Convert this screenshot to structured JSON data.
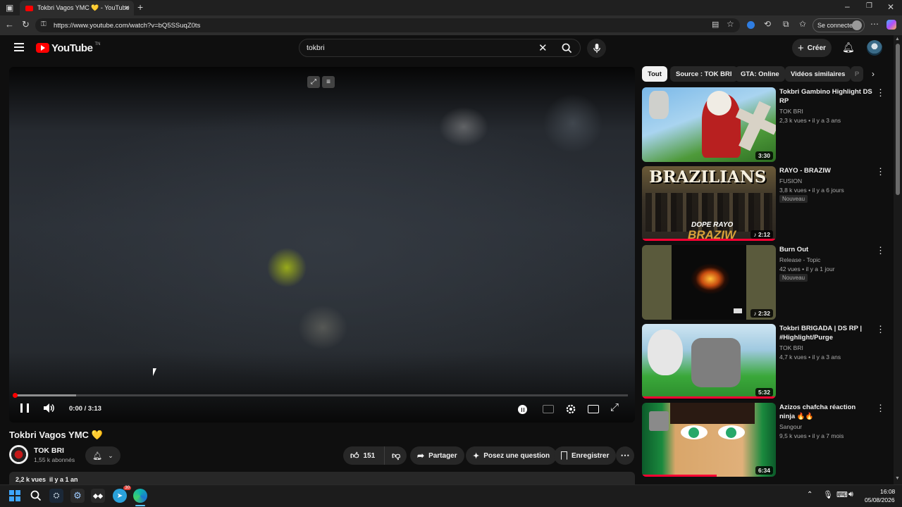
{
  "browser": {
    "tab_title": "Tokbri Vagos YMC 💛 - YouTube",
    "url": "https://www.youtube.com/watch?v=bQ5SSuqZ0ts",
    "signin_label": "Se connecter"
  },
  "youtube": {
    "logo_text": "YouTube",
    "logo_sup": "TN",
    "search_value": "tokbri",
    "create_label": "Créer"
  },
  "player": {
    "time": "0:00 / 3:13",
    "progress_fraction": 0.0,
    "buffered_fraction": 0.1
  },
  "video": {
    "title": "Tokbri Vagos YMC 💛",
    "channel": "TOK BRI",
    "subscribers": "1,55 k abonnés",
    "likes": "151",
    "share_label": "Partager",
    "ask_label": "Posez une question",
    "save_label": "Enregistrer",
    "views_date": "2,2 k vues  il y a 1 an"
  },
  "chips": [
    "Tout",
    "Source : TOK BRI",
    "GTA: Online",
    "Vidéos similaires",
    "P"
  ],
  "recommendations": [
    {
      "title": "Tokbri   Gambino Highlight DS RP",
      "channel": "TOK BRI",
      "meta": "2,3 k vues • il y a 3 ans",
      "duration": "3:30",
      "badge": ""
    },
    {
      "title": "RAYO - BRAZIW",
      "channel": "FUSION",
      "meta": "3,8 k vues • il y a 6 jours",
      "duration": "♪ 2:12",
      "badge": "Nouveau"
    },
    {
      "title": "Burn Out",
      "channel": "Release - Topic",
      "meta": "42 vues • il y a 1 jour",
      "duration": "♪ 2:32",
      "badge": "Nouveau"
    },
    {
      "title": "Tokbri BRIGADA | DS RP | #Highlight/Purge",
      "channel": "TOK BRI",
      "meta": "4,7 k vues • il y a 3 ans",
      "duration": "5:32",
      "badge": ""
    },
    {
      "title": "Azizos chafcha réaction ninja 🔥🔥",
      "channel": "Sangour",
      "meta": "9,5 k vues • il y a 7 mois",
      "duration": "6:34",
      "badge": ""
    }
  ],
  "thumb_text": {
    "brazilians": "BRAZILIANS",
    "dope_rayo": "DOPE RAYO",
    "braziw": "BRAZIW"
  },
  "taskbar": {
    "time": "16:08",
    "date": "05/08/2026",
    "badge": "30"
  }
}
